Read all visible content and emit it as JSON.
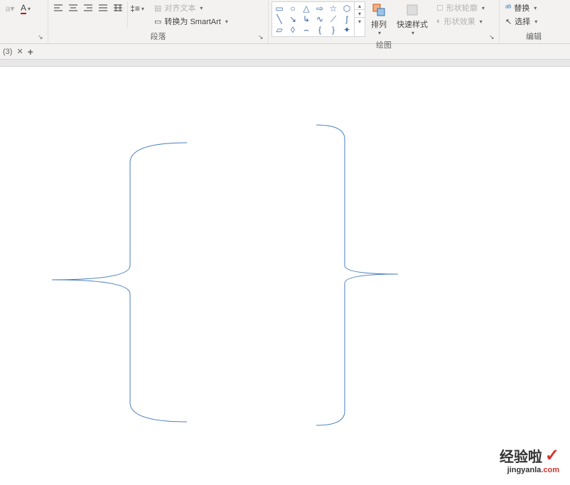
{
  "ribbon": {
    "font": {
      "label": "",
      "style_indicator": "A"
    },
    "paragraph": {
      "label": "段落",
      "align_text_label": "对齐文本",
      "smartart_label": "转换为 SmartArt"
    },
    "drawing": {
      "label": "绘图",
      "arrange_label": "排列",
      "quick_styles_label": "快速样式",
      "shape_outline_label": "形状轮廓",
      "shape_effects_label": "形状效果"
    },
    "editing": {
      "label": "编辑",
      "replace_label": "替换",
      "select_label": "选择"
    }
  },
  "tabs": {
    "current": "(3)"
  },
  "watermark": {
    "main": "经验啦",
    "sub_plain": "jingyanla",
    "sub_red": ".com"
  }
}
